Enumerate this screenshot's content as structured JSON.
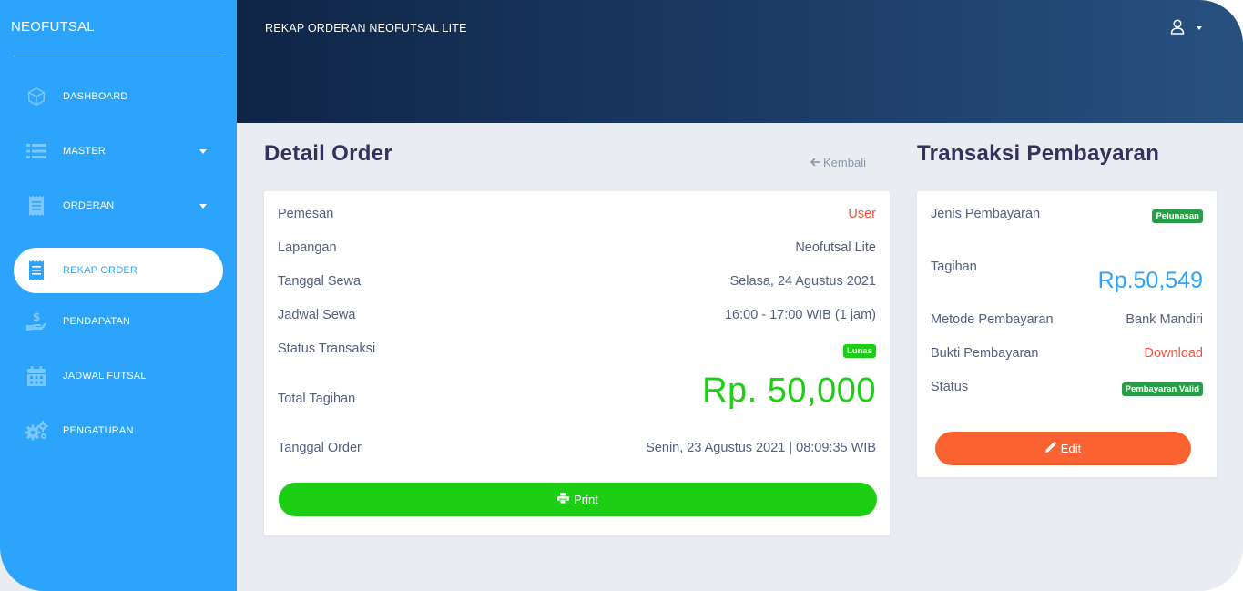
{
  "brand": "NEOFUTSAL",
  "sidebar": {
    "items": [
      {
        "label": "DASHBOARD",
        "icon": "cube-icon"
      },
      {
        "label": "MASTER",
        "icon": "list-icon"
      },
      {
        "label": "ORDERAN",
        "icon": "receipt-icon"
      },
      {
        "label": "REKAP ORDER",
        "icon": "receipt-icon"
      },
      {
        "label": "PENDAPATAN",
        "icon": "hand-dollar-icon"
      },
      {
        "label": "JADWAL FUTSAL",
        "icon": "calendar-icon"
      },
      {
        "label": "PENGATURAN",
        "icon": "gears-icon"
      }
    ]
  },
  "header": {
    "title": "REKAP ORDERAN NEOFUTSAL LITE",
    "user_icon": "user-icon"
  },
  "detail": {
    "title": "Detail Order",
    "back_label": "Kembali",
    "rows": {
      "pemesan": {
        "label": "Pemesan",
        "value": "User"
      },
      "lapangan": {
        "label": "Lapangan",
        "value": "Neofutsal Lite"
      },
      "tanggal_sewa": {
        "label": "Tanggal Sewa",
        "value": "Selasa, 24 Agustus 2021"
      },
      "jadwal_sewa": {
        "label": "Jadwal Sewa",
        "value": "16:00 - 17:00 WIB (1 jam)"
      },
      "status": {
        "label": "Status Transaksi",
        "value": "Lunas"
      },
      "total": {
        "label": "Total Tagihan",
        "value": "Rp. 50,000"
      },
      "tanggal_order": {
        "label": "Tanggal Order",
        "value": "Senin, 23 Agustus 2021 | 08:09:35 WIB"
      }
    },
    "print_label": "Print"
  },
  "transaksi": {
    "title": "Transaksi Pembayaran",
    "rows": {
      "jenis": {
        "label": "Jenis Pembayaran",
        "value": "Pelunasan"
      },
      "tagihan": {
        "label": "Tagihan",
        "value": "Rp.50,549"
      },
      "metode": {
        "label": "Metode Pembayaran",
        "value": "Bank Mandiri"
      },
      "bukti": {
        "label": "Bukti Pembayaran",
        "value": "Download"
      },
      "status": {
        "label": "Status",
        "value": "Pembayaran Valid"
      }
    },
    "edit_label": "Edit"
  },
  "colors": {
    "sidebar": "#2ca4fb",
    "accent_green": "#1ccf14",
    "accent_orange": "#fb6232",
    "accent_red": "#f5533d",
    "accent_blue": "#2ca4fb"
  }
}
